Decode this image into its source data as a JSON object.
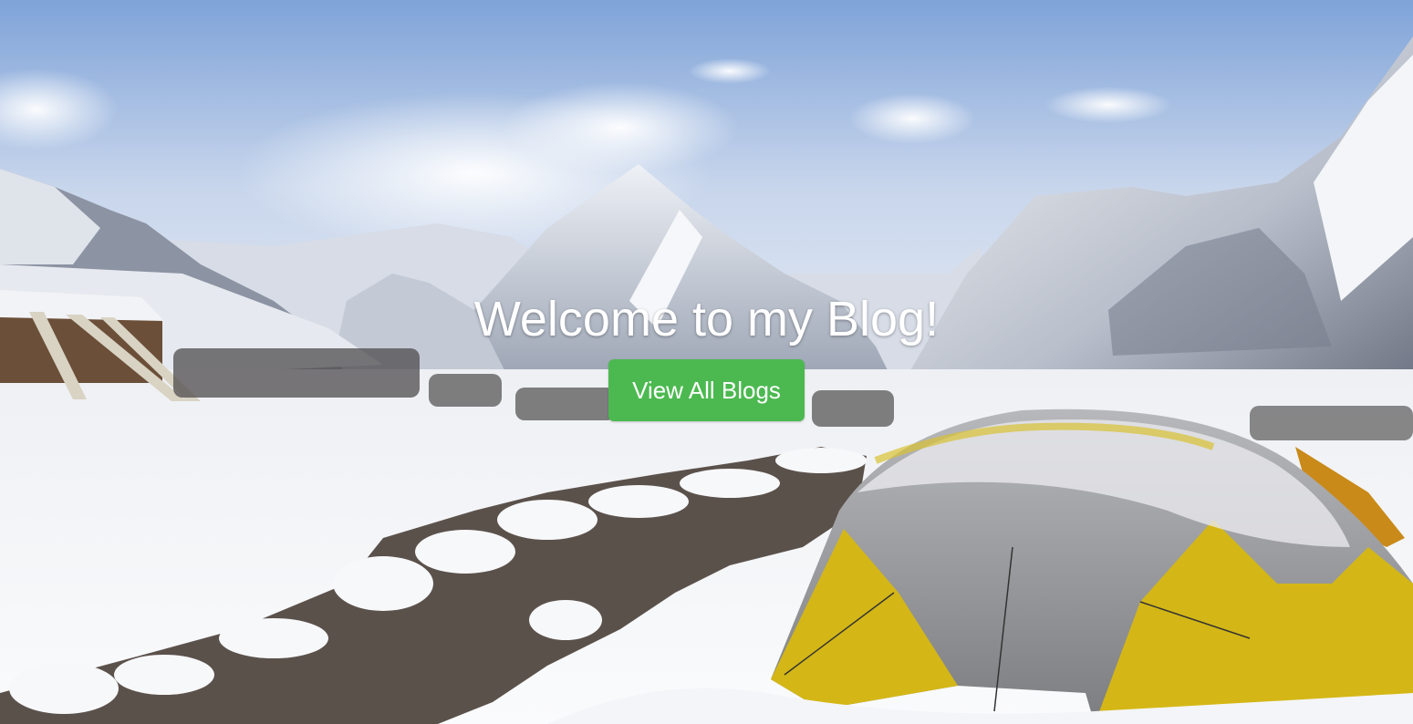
{
  "hero": {
    "title": "Welcome to my Blog!",
    "button_label": "View All Blogs",
    "button_color": "#4cb950"
  },
  "colors": {
    "tent_yellow": "#d4b716",
    "tent_fly": "#8c8c8c",
    "snow": "#f3f4f7",
    "sky_top": "#8fb0de"
  }
}
